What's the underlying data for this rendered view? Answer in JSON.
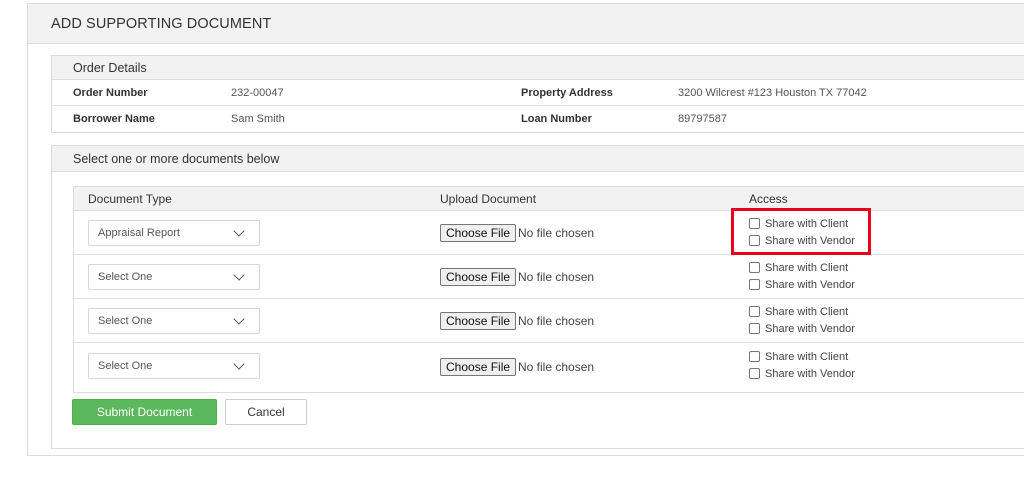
{
  "page": {
    "title": "ADD SUPPORTING DOCUMENT"
  },
  "order_details": {
    "heading": "Order Details",
    "order_number_label": "Order Number",
    "order_number": "232-00047",
    "property_address_label": "Property Address",
    "property_address": "3200 Wilcrest #123 Houston TX 77042",
    "borrower_name_label": "Borrower Name",
    "borrower_name": "Sam Smith",
    "loan_number_label": "Loan Number",
    "loan_number": "89797587"
  },
  "documents": {
    "heading": "Select one or more documents below",
    "columns": {
      "type": "Document Type",
      "upload": "Upload Document",
      "access": "Access"
    },
    "file_button_label": "Choose File",
    "file_status": "No file chosen",
    "share_client_label": "Share with Client",
    "share_vendor_label": "Share with Vendor",
    "rows": [
      {
        "document_type": "Appraisal Report"
      },
      {
        "document_type": "Select One"
      },
      {
        "document_type": "Select One"
      },
      {
        "document_type": "Select One"
      }
    ]
  },
  "actions": {
    "submit_label": "Submit Document",
    "cancel_label": "Cancel"
  },
  "colors": {
    "accent_green": "#5cb85c",
    "highlight_red": "#e8001c"
  }
}
